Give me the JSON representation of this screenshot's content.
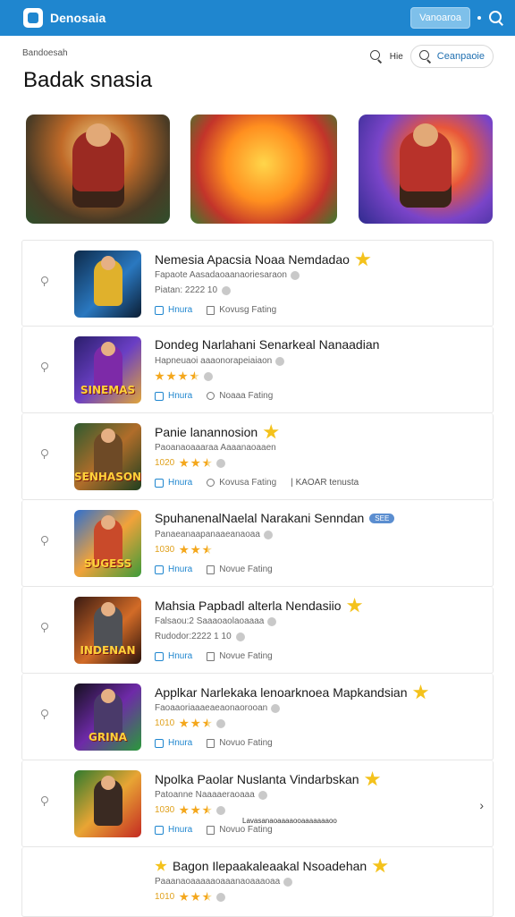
{
  "topbar": {
    "title": "Denosaia",
    "button_label": "Vanoaroa"
  },
  "header": {
    "breadcrumb": "Bandoesah",
    "title": "Badak snasia",
    "search_label": "Hie",
    "pill_label": "Ceanpaoie"
  },
  "list": [
    {
      "title": "Nemesia Apacsia Noaa Nemdadao",
      "subtitle": "Fapaote Aasadaoaanaoriesaraon",
      "meta": "Piatan: 2222 10",
      "action1": "Hnura",
      "action2": "Kovusg Fating",
      "title_badge": "star",
      "meta_type": "text"
    },
    {
      "title": "Dondeg Narlahani Senarkeal Nanaadian",
      "subtitle": "Hapneuaoi aaaonorapeiaiaon",
      "meta": "",
      "action1": "Hnura",
      "action2": "Noaaa Fating",
      "title_badge": "none",
      "meta_type": "stars"
    },
    {
      "title": "Panie lanannosion",
      "subtitle": "Paoanaoaaaraa Aaaanaoaaen",
      "meta": "1020",
      "action1": "Hnura",
      "action2": "Kovusa Fating",
      "extra": "| KAOAR tenusta",
      "title_badge": "star",
      "meta_type": "stars_num"
    },
    {
      "title": "SpuhanenalNaelal Narakani Senndan",
      "subtitle": "Panaeanaapanaaeanaoaa",
      "meta": "1030",
      "action1": "Hnura",
      "action2": "Novue Fating",
      "title_badge": "pill",
      "pill_label": "SEE",
      "meta_type": "stars_num"
    },
    {
      "title": "Mahsia Papbadl alterla Nendasiio",
      "subtitle": "Falsaou:2 Saaaoaolaoaaaa",
      "meta": "Rudodor:2222 1 10",
      "action1": "Hnura",
      "action2": "Novue Fating",
      "title_badge": "star",
      "meta_type": "text"
    },
    {
      "title": "Applkar Narlekaka lenoarknoea Mapkandsian",
      "subtitle": "Faoaaoriaaaeaeaonaorooan",
      "meta": "1010",
      "action1": "Hnura",
      "action2": "Novuo Fating",
      "title_badge": "star",
      "meta_type": "stars_num"
    },
    {
      "title": "Npolka Paolar Nuslanta Vindarbskan",
      "subtitle": "Patoanne Naaaaeraoaaa",
      "meta": "1030",
      "action1": "Hnura",
      "action2": "Novuo Fating",
      "sub_extra": "Lavasanaoaaaaooaaaaaaaoo",
      "title_badge": "star",
      "meta_type": "stars_num"
    },
    {
      "title": "Bagon Ilepaakaleaakal Nsoadehan",
      "subtitle": "Paaanaoaaaaaoaaanaoaaaoaa",
      "meta": "1010",
      "title_badge": "star",
      "meta_type": "stars_num"
    }
  ],
  "colors": {
    "accent": "#1f86cf",
    "star": "#f4c21c"
  }
}
